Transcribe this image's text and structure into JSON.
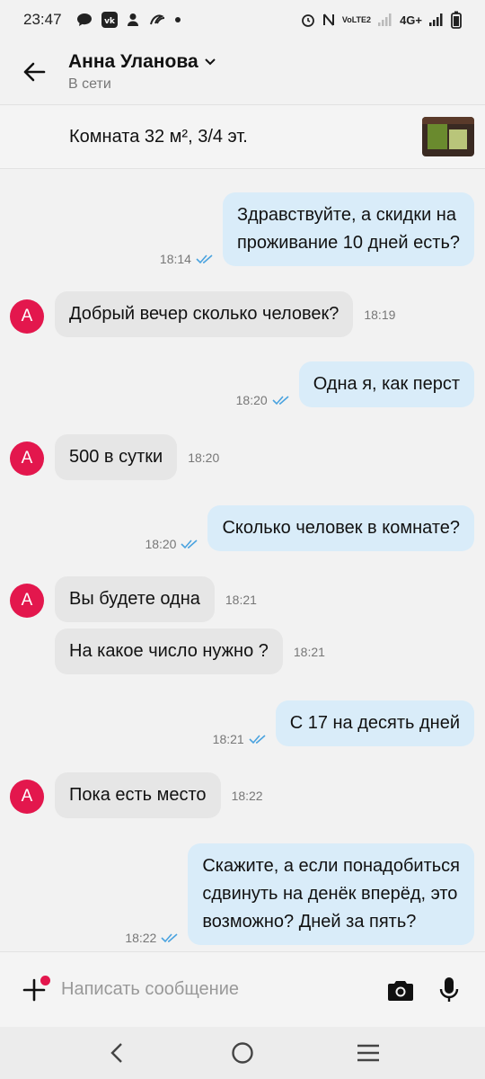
{
  "status_bar": {
    "time": "23:47",
    "network": "4G+",
    "volte": "VoLTE2"
  },
  "header": {
    "contact_name": "Анна Уланова",
    "contact_status": "В сети",
    "avatar_letter": "А"
  },
  "listing": {
    "title": "Комната 32 м², 3/4 эт."
  },
  "messages": [
    {
      "dir": "out",
      "lines": [
        "Здравствуйте, а скидки на",
        "проживание 10 дней есть?"
      ],
      "time": "18:14",
      "read": true
    },
    {
      "dir": "in",
      "text": "Добрый вечер сколько человек?",
      "time": "18:19"
    },
    {
      "dir": "out",
      "text": "Одна я, как перст",
      "time": "18:20",
      "read": true
    },
    {
      "dir": "in",
      "text": "500 в сутки",
      "time": "18:20"
    },
    {
      "dir": "out",
      "text": "Сколько человек в комнате?",
      "time": "18:20",
      "read": true
    },
    {
      "dir": "in",
      "text": "Вы будете одна",
      "time": "18:21"
    },
    {
      "dir": "in",
      "text": "На какое число нужно ?",
      "time": "18:21"
    },
    {
      "dir": "out",
      "text": "С 17 на десять дней",
      "time": "18:21",
      "read": true
    },
    {
      "dir": "in",
      "text": "Пока есть место",
      "time": "18:22"
    },
    {
      "dir": "out",
      "lines": [
        "Скажите, а если понадобиться",
        "сдвинуть на денёк вперёд, это",
        "возможно? Дней за пять?"
      ],
      "time": "18:22",
      "read": true
    }
  ],
  "composer": {
    "placeholder": "Написать сообщение"
  },
  "colors": {
    "accent": "#e3174d",
    "out_bubble": "#d9ecf9",
    "in_bubble": "#e6e6e6",
    "read_check": "#4aa3df"
  }
}
